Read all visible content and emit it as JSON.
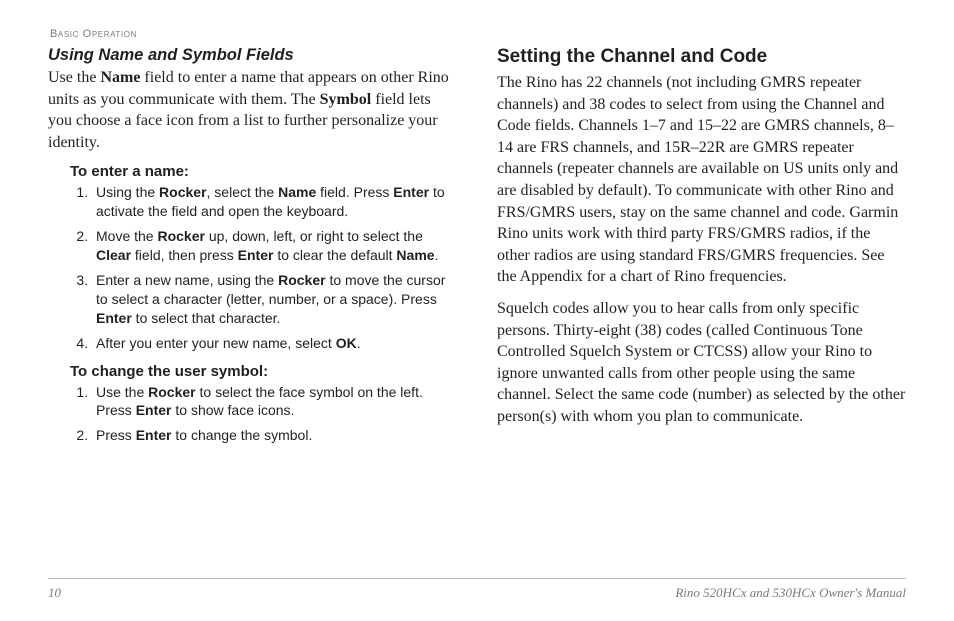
{
  "running_head": "Basic Operation",
  "left": {
    "heading_sub": "Using Name and Symbol Fields",
    "intro_parts": [
      "Use the ",
      "Name",
      " field to enter a name that appears on other Rino units as you communicate with them. The ",
      "Symbol",
      " field lets you choose a face icon from a list to further personalize your identity."
    ],
    "proc1_head": "To enter a name:",
    "proc1": [
      [
        "Using the ",
        "Rocker",
        ", select the ",
        "Name",
        " field. Press ",
        "Enter",
        " to activate the field and open the keyboard."
      ],
      [
        "Move the ",
        "Rocker",
        " up, down, left, or right to select the ",
        "Clear",
        " field, then press ",
        "Enter",
        " to clear the default ",
        "Name",
        "."
      ],
      [
        "Enter a new name, using the ",
        "Rocker",
        " to move the cursor to select a character (letter, number, or a space). Press ",
        "Enter",
        " to select that character."
      ],
      [
        "After you enter your new name, select ",
        "OK",
        "."
      ]
    ],
    "proc2_head": "To change the user symbol:",
    "proc2": [
      [
        "Use the ",
        "Rocker",
        " to select the face symbol on the left. Press ",
        "Enter",
        " to show face icons."
      ],
      [
        "Press ",
        "Enter",
        " to change the symbol."
      ]
    ]
  },
  "right": {
    "heading_main": "Setting the Channel and Code",
    "para1": "The Rino has 22 channels (not including GMRS repeater channels) and 38 codes to select from using the Channel and Code fields. Channels 1–7 and 15–22 are GMRS channels, 8–14 are FRS channels, and 15R–22R are GMRS repeater channels (repeater channels are available on US units only and are disabled by default). To communicate with other Rino and FRS/GMRS users, stay on the same channel and code. Garmin Rino units work with third party FRS/GMRS radios, if the other radios are using standard FRS/GMRS frequencies. See the Appendix for a chart of Rino frequencies.",
    "para2": "Squelch codes allow you to hear calls from only specific persons. Thirty-eight (38) codes (called Continuous Tone Controlled Squelch System or CTCSS) allow your Rino to ignore unwanted calls from other people using the same channel. Select the same code (number) as selected by the other person(s) with whom you plan to communicate."
  },
  "footer": {
    "page_number": "10",
    "manual_title": "Rino 520HCx and 530HCx Owner's Manual"
  }
}
